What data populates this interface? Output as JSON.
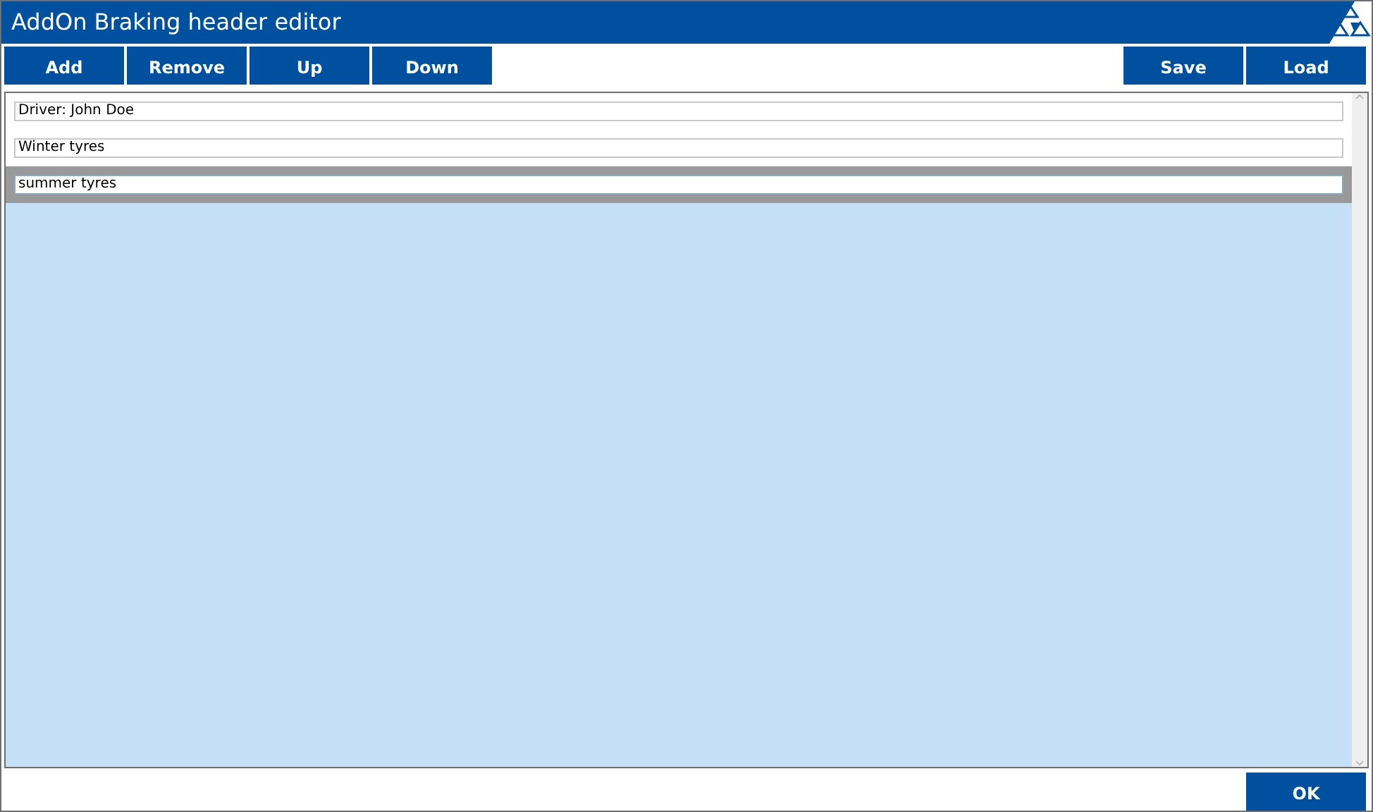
{
  "window": {
    "title": "AddOn Braking header editor"
  },
  "toolbar_left": [
    "Add",
    "Remove",
    "Up",
    "Down"
  ],
  "toolbar_right": [
    "Save",
    "Load"
  ],
  "entries": [
    {
      "value": "Driver: John Doe",
      "selected": false
    },
    {
      "value": "Winter tyres",
      "selected": false
    },
    {
      "value": "summer tyres",
      "selected": true
    }
  ],
  "footer_buttons": [
    "OK"
  ]
}
